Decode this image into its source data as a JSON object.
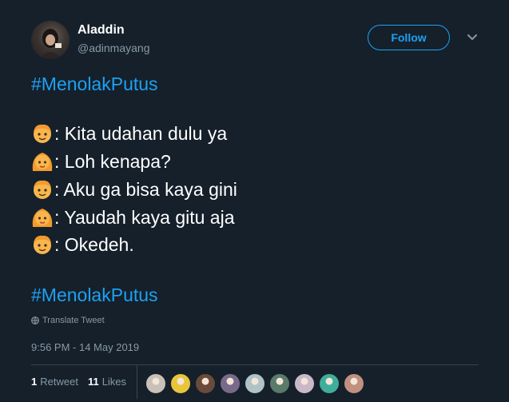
{
  "author": {
    "name": "Aladdin",
    "handle": "@adinmayang"
  },
  "follow_label": "Follow",
  "tweet": {
    "hashtag_top": "#MenolakPutus",
    "lines": [
      {
        "speaker": "boy",
        "text": ": Kita udahan dulu ya"
      },
      {
        "speaker": "girl",
        "text": ": Loh kenapa?"
      },
      {
        "speaker": "boy",
        "text": ": Aku ga bisa kaya gini"
      },
      {
        "speaker": "girl",
        "text": ": Yaudah kaya gitu aja"
      },
      {
        "speaker": "boy",
        "text": ": Okedeh."
      }
    ],
    "hashtag_bottom": "#MenolakPutus"
  },
  "translate_label": "Translate Tweet",
  "timestamp": "9:56 PM - 14 May 2019",
  "stats": {
    "retweets_count": "1",
    "retweets_label": "Retweet",
    "likes_count": "11",
    "likes_label": "Likes"
  },
  "liker_colors": [
    "#c9c1b8",
    "#e8c53a",
    "#6a4a3a",
    "#7a6a8a",
    "#b0c4c8",
    "#5a7a6a",
    "#c8b8c8",
    "#3fae9a",
    "#c09080"
  ],
  "colors": {
    "background": "#15202b",
    "accent": "#1da1f2",
    "muted": "#8899a6"
  }
}
